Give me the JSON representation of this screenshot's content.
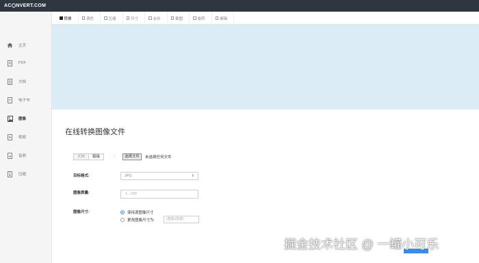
{
  "brand": {
    "prefix": "AC",
    "suffix": "NVERT.COM"
  },
  "sidebar": {
    "items": [
      {
        "label": "主页",
        "icon": "home-icon"
      },
      {
        "label": "PDF",
        "icon": "pdf-file-icon"
      },
      {
        "label": "文档",
        "icon": "document-icon"
      },
      {
        "label": "电子书",
        "icon": "ebook-icon"
      },
      {
        "label": "图像",
        "icon": "image-icon",
        "active": true
      },
      {
        "label": "视频",
        "icon": "video-icon"
      },
      {
        "label": "音频",
        "icon": "audio-icon"
      },
      {
        "label": "压缩",
        "icon": "archive-icon"
      }
    ]
  },
  "tabs": [
    {
      "label": "转换",
      "active": true
    },
    {
      "label": "调色"
    },
    {
      "label": "压缩"
    },
    {
      "label": "尺寸"
    },
    {
      "label": "合并"
    },
    {
      "label": "截图"
    },
    {
      "label": "旋转"
    },
    {
      "label": "编辑"
    }
  ],
  "main": {
    "title": "在线转换图像文件",
    "source": {
      "option_off": "文档",
      "option_on": "链接",
      "colon": ":"
    },
    "file": {
      "button": "选择文件",
      "status": "未选择任何文件"
    },
    "format": {
      "label": "目标格式:",
      "value": "JPG"
    },
    "quality": {
      "label": "图像质量:",
      "placeholder": "1...100"
    },
    "size": {
      "label": "图像尺寸:",
      "option_keep": "保持源图像尺寸",
      "option_change": "更改图像尺寸为:",
      "dim_placeholder": "(宽度x高度)"
    }
  },
  "watermark": "掘金技术社区 @ 一罐小可乐",
  "colors": {
    "dark": "#2f3640",
    "banner": "#dcecf6",
    "accent": "#3a8ee6"
  }
}
